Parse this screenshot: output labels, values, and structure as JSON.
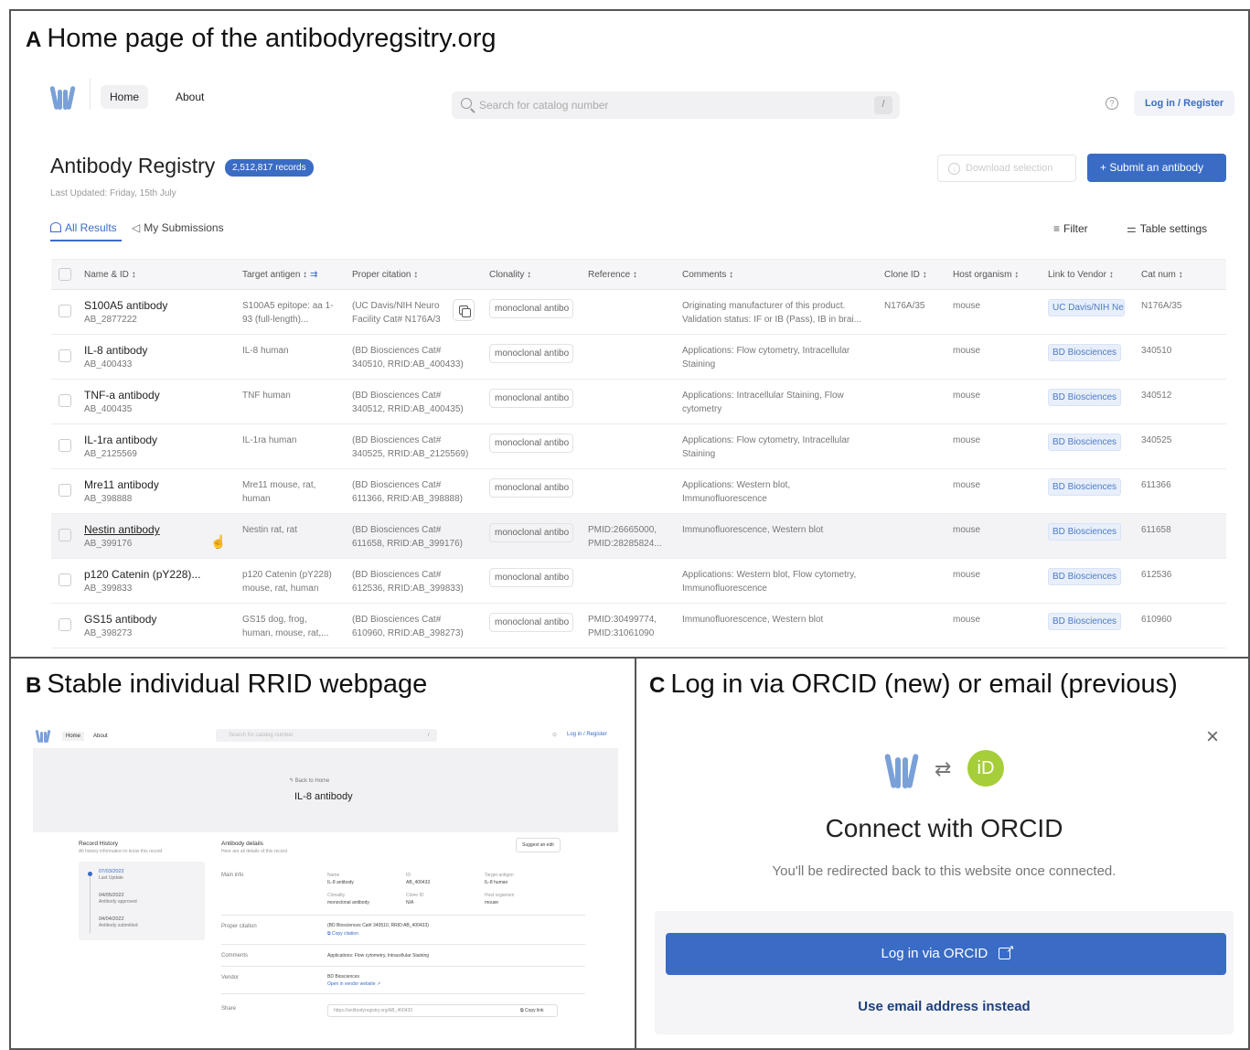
{
  "panel_a": {
    "letter": "A",
    "caption": "Home page of the antibodyregsitry.org",
    "nav": {
      "home": "Home",
      "about": "About",
      "search_placeholder": "Search for catalog number",
      "search_shortcut": "/",
      "login": "Log in / Register"
    },
    "title": "Antibody Registry",
    "records_badge": "2,512,817 records",
    "last_updated": "Last Updated: Friday, 15th July",
    "download_label": "Download selection",
    "submit_label": "+ Submit an antibody",
    "tabs": {
      "all": "All Results",
      "mine": "My Submissions"
    },
    "filter": "Filter",
    "table_settings": "Table settings",
    "columns": [
      "Name & ID ↕",
      "Target antigen ↕",
      "Proper citation ↕",
      "Clonality ↕",
      "Reference ↕",
      "Comments ↕",
      "Clone ID ↕",
      "Host organism ↕",
      "Link to Vendor ↕",
      "Cat num ↕"
    ],
    "rows": [
      {
        "name": "S100A5 antibody",
        "id": "AB_2877222",
        "target": "S100A5 epitope: aa 1-93 (full-length)...",
        "citation": "(UC Davis/NIH Neuro Facility Cat# N176A/3",
        "clonality": "monoclonal antibo",
        "reference": "",
        "comments": "Originating manufacturer of this product. Validation status: IF or IB (Pass), IB in brai...",
        "clone": "N176A/35",
        "host": "mouse",
        "vendor": "UC Davis/NIH Neu",
        "cat": "N176A/35"
      },
      {
        "name": "IL-8 antibody",
        "id": "AB_400433",
        "target": "IL-8 human",
        "citation": "(BD Biosciences Cat# 340510, RRID:AB_400433)",
        "clonality": "monoclonal antibo",
        "reference": "",
        "comments": "Applications: Flow cytometry, Intracellular Staining",
        "clone": "",
        "host": "mouse",
        "vendor": "BD Biosciences",
        "cat": "340510"
      },
      {
        "name": "TNF-a antibody",
        "id": "AB_400435",
        "target": "TNF human",
        "citation": "(BD Biosciences Cat# 340512, RRID:AB_400435)",
        "clonality": "monoclonal antibo",
        "reference": "",
        "comments": "Applications: Intracellular Staining, Flow cytometry",
        "clone": "",
        "host": "mouse",
        "vendor": "BD Biosciences",
        "cat": "340512"
      },
      {
        "name": "IL-1ra antibody",
        "id": "AB_2125569",
        "target": "IL-1ra human",
        "citation": "(BD Biosciences Cat# 340525, RRID:AB_2125569)",
        "clonality": "monoclonal antibo",
        "reference": "",
        "comments": "Applications: Flow cytometry, Intracellular Staining",
        "clone": "",
        "host": "mouse",
        "vendor": "BD Biosciences",
        "cat": "340525"
      },
      {
        "name": "Mre11 antibody",
        "id": "AB_398888",
        "target": "Mre11 mouse, rat, human",
        "citation": "(BD Biosciences Cat# 611366, RRID:AB_398888)",
        "clonality": "monoclonal antibo",
        "reference": "",
        "comments": "Applications: Western blot, Immunofluorescence",
        "clone": "",
        "host": "mouse",
        "vendor": "BD Biosciences",
        "cat": "611366"
      },
      {
        "name": "Nestin antibody",
        "id": "AB_399176",
        "target": "Nestin rat, rat",
        "citation": "(BD Biosciences Cat# 611658, RRID:AB_399176)",
        "clonality": "monoclonal antibo",
        "reference": "PMID:26665000, PMID:28285824...",
        "comments": "Immunofluorescence, Western blot",
        "clone": "",
        "host": "mouse",
        "vendor": "BD Biosciences",
        "cat": "611658"
      },
      {
        "name": "p120 Catenin (pY228)...",
        "id": "AB_399833",
        "target": "p120 Catenin (pY228) mouse, rat, human",
        "citation": "(BD Biosciences Cat# 612536, RRID:AB_399833)",
        "clonality": "monoclonal antibo",
        "reference": "",
        "comments": "Applications: Western blot, Flow cytometry, Immunofluorescence",
        "clone": "",
        "host": "mouse",
        "vendor": "BD Biosciences",
        "cat": "612536"
      },
      {
        "name": "GS15 antibody",
        "id": "AB_398273",
        "target": "GS15 dog, frog, human, mouse, rat,...",
        "citation": "(BD Biosciences Cat# 610960, RRID:AB_398273)",
        "clonality": "monoclonal antibo",
        "reference": "PMID:30499774, PMID:31061090",
        "comments": "Immunofluorescence, Western blot",
        "clone": "",
        "host": "mouse",
        "vendor": "BD Biosciences",
        "cat": "610960"
      }
    ]
  },
  "panel_b": {
    "letter": "B",
    "caption": "Stable individual RRID webpage",
    "nav": {
      "home": "Home",
      "about": "About",
      "search": "Search for catalog number",
      "shortcut": "/",
      "login": "Log in / Register"
    },
    "back": "↰ Back to Home",
    "title": "IL-8 antibody",
    "history_title": "Record History",
    "history_sub": "All history information to know this record",
    "history": [
      {
        "date": "07/03/2022",
        "label": "Last Update"
      },
      {
        "date": "04/05/2022",
        "label": "Antibody approved"
      },
      {
        "date": "04/04/2022",
        "label": "Antibody submitted"
      }
    ],
    "details_title": "Antibody details",
    "details_sub": "Here are all details of this record",
    "suggest": "Suggest an edit",
    "main_info": "Main info",
    "fields": [
      {
        "k": "Name",
        "v": "IL-8 antibody"
      },
      {
        "k": "ID",
        "v": "AB_400433"
      },
      {
        "k": "Target antigen",
        "v": "IL-8 human"
      },
      {
        "k": "Clonality",
        "v": "monoclonal antibody"
      },
      {
        "k": "Clone ID",
        "v": "N/A"
      },
      {
        "k": "Host organism",
        "v": "mouse"
      }
    ],
    "citation_label": "Proper citation",
    "citation": "(BD Biosciences Cat# 340510, RRID:AB_400433)",
    "copy_citation": "Copy citation",
    "comments_label": "Comments",
    "comments": "Applications: Flow cytometry, Intracellular Staining",
    "vendor_label": "Vendor",
    "vendor": "BD Biosciences",
    "vendor_link": "Open in vendor website",
    "share_label": "Share",
    "share_url": "https://antibodyregistry.org/AB_400433",
    "copy_link": "Copy link"
  },
  "panel_c": {
    "letter": "C",
    "caption": "Log in via ORCID (new) or email (previous)",
    "close": "×",
    "swap": "⇄",
    "orcid_mark": "iD",
    "title": "Connect with ORCID",
    "subtitle": "You'll be redirected back to this website once connected.",
    "orcid_button": "Log in via ORCID",
    "email_button": "Use email address instead"
  },
  "colors": {
    "primary": "#3a6cc5",
    "orcid_green": "#a6ce39",
    "logo_blue": "#7aa0d8",
    "border": "#555555"
  }
}
